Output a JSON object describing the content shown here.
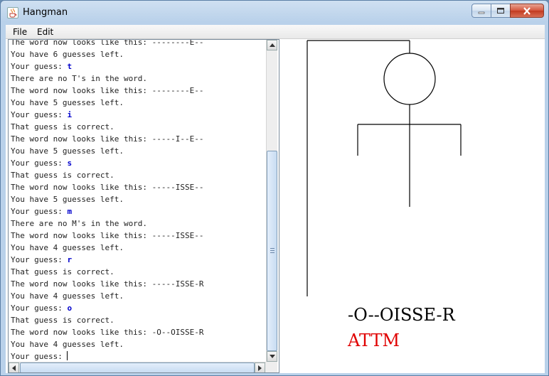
{
  "window": {
    "title": "Hangman"
  },
  "menu": {
    "file_label": "File",
    "edit_label": "Edit"
  },
  "console": {
    "lines": [
      {
        "text": "The word now looks like this: --------E--"
      },
      {
        "text": "You have 6 guesses left."
      },
      {
        "text": "Your guess: ",
        "guess": "t"
      },
      {
        "text": "There are no T's in the word."
      },
      {
        "text": "The word now looks like this: --------E--"
      },
      {
        "text": "You have 5 guesses left."
      },
      {
        "text": "Your guess: ",
        "guess": "i"
      },
      {
        "text": "That guess is correct."
      },
      {
        "text": "The word now looks like this: -----I--E--"
      },
      {
        "text": "You have 5 guesses left."
      },
      {
        "text": "Your guess: ",
        "guess": "s"
      },
      {
        "text": "That guess is correct."
      },
      {
        "text": "The word now looks like this: -----ISSE--"
      },
      {
        "text": "You have 5 guesses left."
      },
      {
        "text": "Your guess: ",
        "guess": "m"
      },
      {
        "text": "There are no M's in the word."
      },
      {
        "text": "The word now looks like this: -----ISSE--"
      },
      {
        "text": "You have 4 guesses left."
      },
      {
        "text": "Your guess: ",
        "guess": "r"
      },
      {
        "text": "That guess is correct."
      },
      {
        "text": "The word now looks like this: -----ISSE-R"
      },
      {
        "text": "You have 4 guesses left."
      },
      {
        "text": "Your guess: ",
        "guess": "o"
      },
      {
        "text": "That guess is correct."
      },
      {
        "text": "The word now looks like this: -O--OISSE-R"
      },
      {
        "text": "You have 4 guesses left."
      },
      {
        "text": "Your guess: ",
        "guess": "",
        "caret": true
      }
    ]
  },
  "game": {
    "word_display": "-O--OISSE-R",
    "wrong_letters": "ATTM"
  },
  "colors": {
    "guess_text": "#0000cc",
    "wrong_letters": "#e00000"
  }
}
